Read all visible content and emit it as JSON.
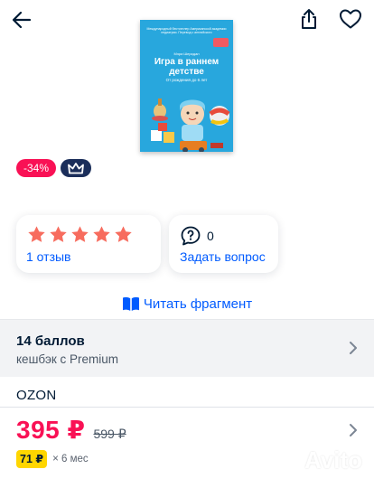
{
  "header": {
    "back_icon": "arrow-left-icon",
    "share_icon": "share-icon",
    "favorite_icon": "heart-icon"
  },
  "book": {
    "publisher_line": "Международный бестселлер Американской академии педиатрии. Перевод с английского",
    "author": "Мэри Шеридан",
    "title": "Игра в раннем детстве",
    "tagline": "От рождения до 6 лет"
  },
  "badges": {
    "discount": "-34%",
    "premium_icon": "crown-icon"
  },
  "rating": {
    "stars": 5,
    "reviews_label": "1 отзыв"
  },
  "questions": {
    "count": "0",
    "ask_label": "Задать вопрос",
    "icon": "question-bubble-icon"
  },
  "fragment": {
    "label": "Читать фрагмент",
    "icon": "open-book-icon"
  },
  "cashback": {
    "title": "14 баллов",
    "subtitle": "кешбэк с Premium"
  },
  "seller": {
    "name": "OZON"
  },
  "price": {
    "current": "395 ₽",
    "old": "599 ₽"
  },
  "installment": {
    "amount": "71 ₽",
    "term": "× 6 мес"
  },
  "watermark": {
    "text": "Avito"
  },
  "colors": {
    "accent": "#005bff",
    "sale": "#f91155",
    "star": "#f76c5e",
    "premium": "#1b2e5a",
    "installment": "#ffd600"
  }
}
